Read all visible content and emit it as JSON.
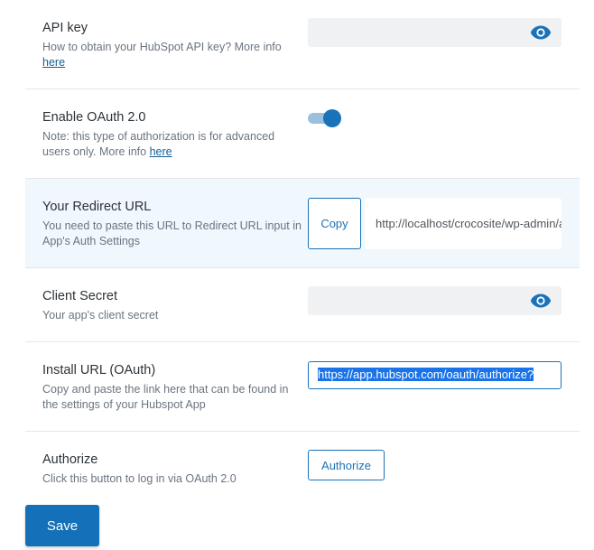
{
  "api_key": {
    "title": "API key",
    "desc": "How to obtain your HubSpot API key? More info",
    "link": "here",
    "value": "",
    "icon": "eye-icon"
  },
  "oauth": {
    "title": "Enable OAuth 2.0",
    "desc": "Note: this type of authorization is for advanced users only. More info",
    "link": "here",
    "enabled": true
  },
  "redirect": {
    "title": "Your Redirect URL",
    "desc": "You need to paste this URL to Redirect URL input in App's Auth Settings",
    "copy_label": "Copy",
    "url": "http://localhost/crocosite/wp-admin/admin.php?page=hubspot"
  },
  "client_secret": {
    "title": "Client Secret",
    "desc": "Your app's client secret",
    "value": "",
    "icon": "eye-icon"
  },
  "install_url": {
    "title": "Install URL (OAuth)",
    "desc": "Copy and paste the link here that can be found in the settings of your Hubspot App",
    "value": "https://app.hubspot.com/oauth/authorize?"
  },
  "authorize": {
    "title": "Authorize",
    "desc": "Click this button to log in via OAuth 2.0",
    "button_label": "Authorize"
  },
  "save_label": "Save",
  "colors": {
    "accent": "#1a72b8",
    "highlight_row": "#f0f7fd",
    "field_bg": "#f0f1f2"
  }
}
